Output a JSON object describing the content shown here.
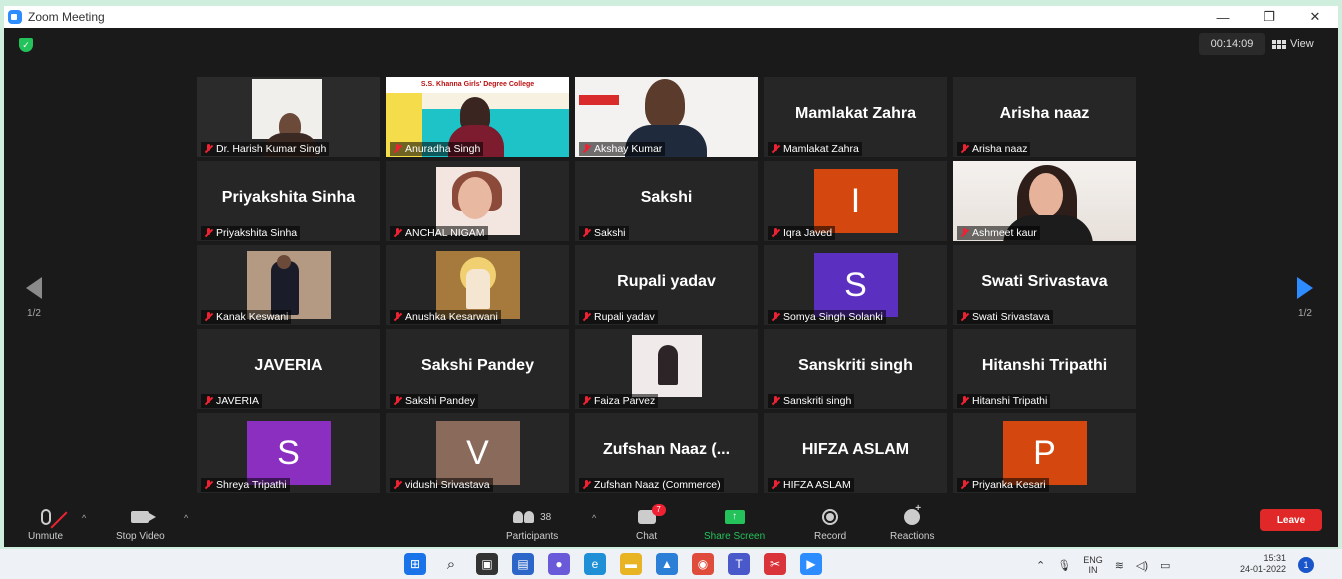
{
  "window": {
    "title": "Zoom Meeting",
    "controls": {
      "minimize": "—",
      "maximize": "❐",
      "close": "✕"
    }
  },
  "meeting": {
    "timer": "00:14:09",
    "view_label": "View",
    "page_indicator_left": "1/2",
    "page_indicator_right": "1/2",
    "active_speaker_color": "#cbe86b"
  },
  "participants": [
    {
      "name": "Dr. Harish Kumar Singh",
      "display": "video-harish",
      "active": true
    },
    {
      "name": "Anuradha Singh",
      "display": "video-anuradha",
      "banner": "S.S. Khanna Girls' Degree College"
    },
    {
      "name": "Akshay Kumar",
      "display": "video-akshay"
    },
    {
      "name": "Mamlakat Zahra",
      "display": "name",
      "big_name": "Mamlakat Zahra"
    },
    {
      "name": "Arisha naaz",
      "display": "name",
      "big_name": "Arisha naaz"
    },
    {
      "name": "Priyakshita Sinha",
      "display": "name",
      "big_name": "Priyakshita Sinha"
    },
    {
      "name": "ANCHAL NIGAM",
      "display": "video-anchal"
    },
    {
      "name": "Sakshi",
      "display": "name",
      "big_name": "Sakshi"
    },
    {
      "name": "Iqra Javed",
      "display": "avatar",
      "letter": "I",
      "color": "#d4480f"
    },
    {
      "name": "Ashmeet kaur",
      "display": "video-ashmeet"
    },
    {
      "name": "Kanak Keswani",
      "display": "video-kanak"
    },
    {
      "name": "Anushka Kesarwani",
      "display": "video-anushka"
    },
    {
      "name": "Rupali yadav",
      "display": "name",
      "big_name": "Rupali yadav"
    },
    {
      "name": "Somya Singh Solanki",
      "display": "avatar",
      "letter": "S",
      "color": "#5b2fbf"
    },
    {
      "name": "Swati Srivastava",
      "display": "name",
      "big_name": "Swati Srivastava"
    },
    {
      "name": "JAVERIA",
      "display": "name",
      "big_name": "JAVERIA"
    },
    {
      "name": "Sakshi Pandey",
      "display": "name",
      "big_name": "Sakshi Pandey"
    },
    {
      "name": "Faiza Parvez",
      "display": "video-faiza"
    },
    {
      "name": "Sanskriti singh",
      "display": "name",
      "big_name": "Sanskriti singh"
    },
    {
      "name": "Hitanshi Tripathi",
      "display": "name",
      "big_name": "Hitanshi Tripathi"
    },
    {
      "name": "Shreya Tripathi",
      "display": "avatar",
      "letter": "S",
      "color": "#8a2fbf"
    },
    {
      "name": "vidushi Srivastava",
      "display": "avatar",
      "letter": "V",
      "color": "#8a6a5a"
    },
    {
      "name": "Zufshan Naaz (Commerce)",
      "display": "name",
      "big_name": "Zufshan  Naaz  (..."
    },
    {
      "name": "HIFZA ASLAM",
      "display": "name",
      "big_name": "HIFZA ASLAM"
    },
    {
      "name": "Priyanka Kesari",
      "display": "avatar",
      "letter": "P",
      "color": "#d4480f"
    }
  ],
  "toolbar": {
    "unmute": "Unmute",
    "stop_video": "Stop Video",
    "participants": "Participants",
    "participants_count": "38",
    "chat": "Chat",
    "chat_badge": "7",
    "share_screen": "Share Screen",
    "record": "Record",
    "reactions": "Reactions",
    "leave": "Leave",
    "caret": "^",
    "share_color": "#23c25a",
    "leave_color": "#e02828"
  },
  "taskbar": {
    "lang_line1": "ENG",
    "lang_line2": "IN",
    "time": "15:31",
    "date": "24-01-2022",
    "notification_count": "1"
  }
}
